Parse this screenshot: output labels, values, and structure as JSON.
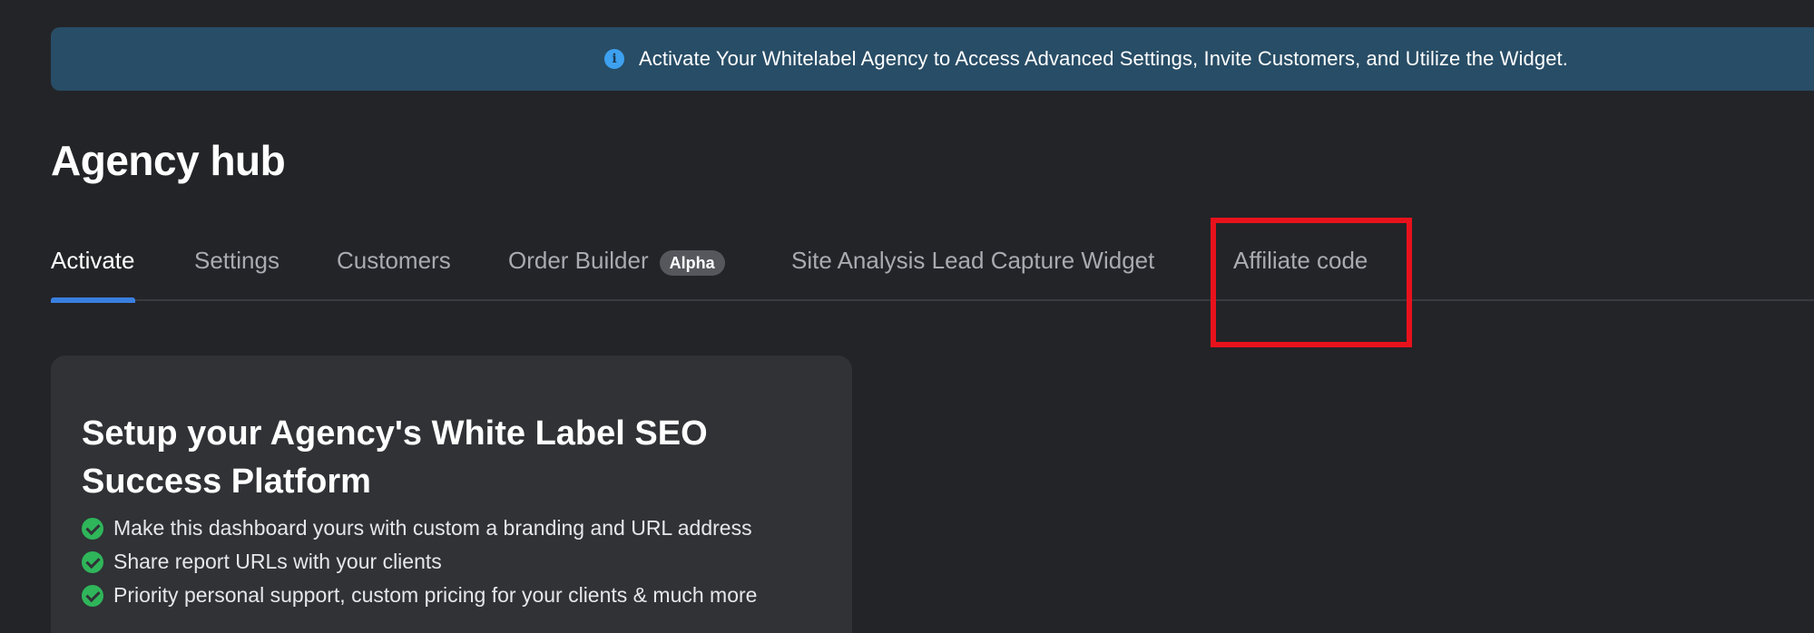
{
  "banner": {
    "text": "Activate Your Whitelabel Agency to Access Advanced Settings, Invite Customers, and Utilize the Widget.",
    "icon": "info-icon",
    "icon_glyph": "i",
    "color": "#284d66"
  },
  "page": {
    "title": "Agency hub"
  },
  "tabs": [
    {
      "label": "Activate",
      "active": true
    },
    {
      "label": "Settings",
      "active": false
    },
    {
      "label": "Customers",
      "active": false
    },
    {
      "label": "Order Builder",
      "badge": "Alpha",
      "active": false
    },
    {
      "label": "Site Analysis Lead Capture Widget",
      "active": false
    },
    {
      "label": "Affiliate code",
      "active": false,
      "highlighted": true
    }
  ],
  "card": {
    "title": "Setup your Agency's White Label SEO Success Platform",
    "features": [
      "Make this dashboard yours with custom a branding and URL address",
      "Share report URLs with your clients",
      "Priority personal support, custom pricing for your clients & much more"
    ]
  },
  "colors": {
    "background": "#232428",
    "active_tab_indicator": "#3a7fe0",
    "highlight_box": "#e8121c",
    "check": "#2fb55a"
  }
}
